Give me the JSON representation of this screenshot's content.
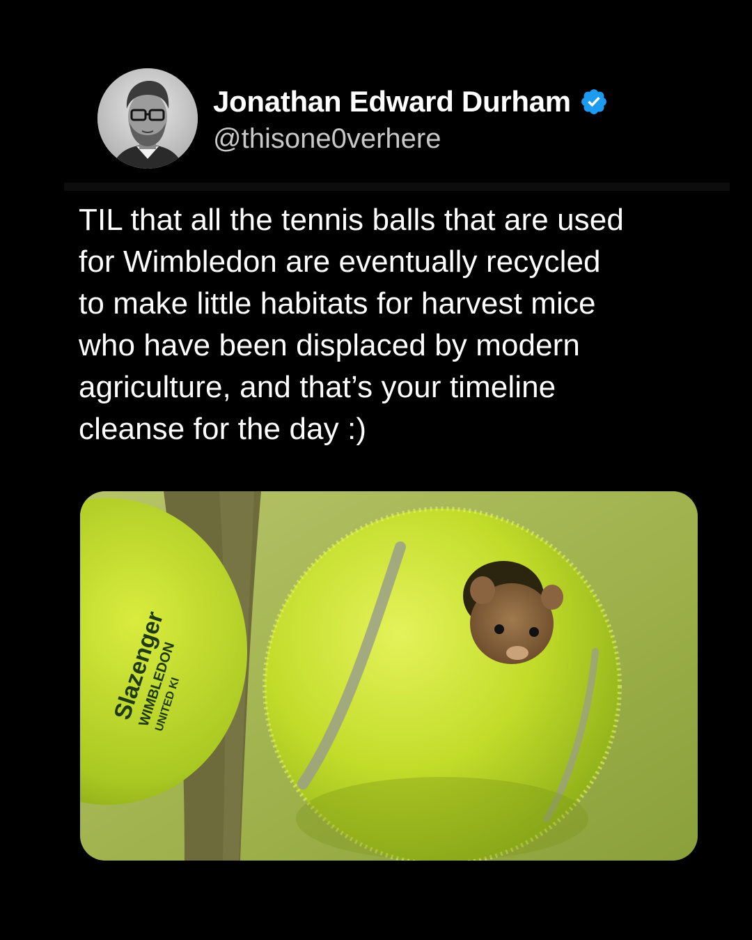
{
  "tweet": {
    "author": {
      "display_name": "Jonathan Edward Durham",
      "handle": "@thisone0verhere",
      "verified": true,
      "verified_badge_icon": "verified-badge-icon",
      "verified_badge_color": "#1d9bf0"
    },
    "text": "TIL that all the tennis balls that are used\nfor Wimbledon are eventually recycled\nto make little habitats for harvest mice\nwho have been displaced by modern\nagriculture, and that’s your timeline\ncleanse for the day :)",
    "media": {
      "ball_brand_text": "Slazenger",
      "ball_event_text": "WIMBLEDON",
      "ball_country_text": "UNITED KI"
    }
  },
  "colors": {
    "background": "#000000",
    "text_primary": "#ffffff",
    "text_secondary": "#c8c8c8",
    "tennis_ball": "#c8e02a"
  }
}
